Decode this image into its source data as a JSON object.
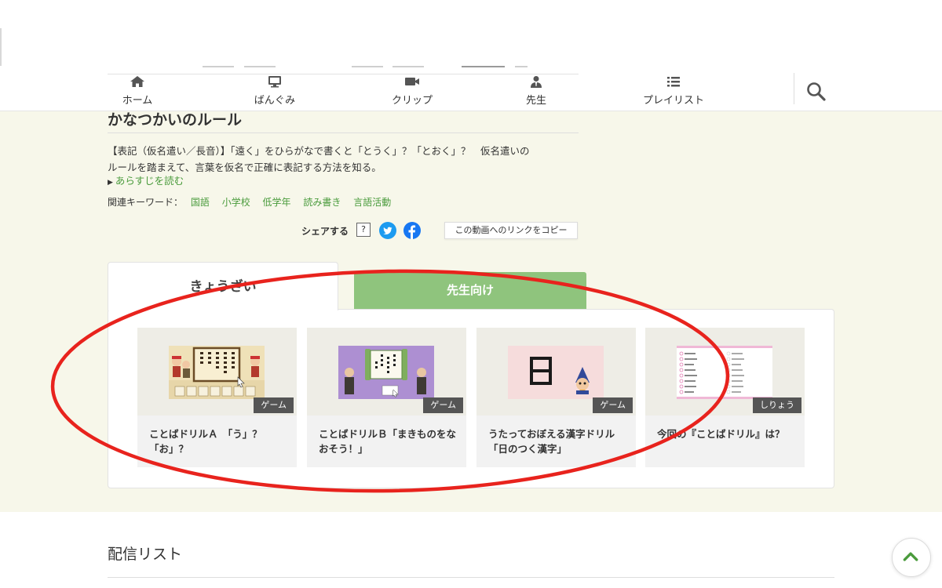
{
  "nav": {
    "items": [
      {
        "label": "ホーム",
        "icon": "home-icon"
      },
      {
        "label": "ばんぐみ",
        "icon": "tv-icon"
      },
      {
        "label": "クリップ",
        "icon": "video-camera-icon"
      },
      {
        "label": "先生",
        "icon": "teacher-icon"
      },
      {
        "label": "プレイリスト",
        "icon": "list-icon"
      }
    ],
    "search_icon": "search-icon"
  },
  "program": {
    "title": "かなつかいのルール",
    "description": "【表記（仮名遣い／長音）】「遠く」をひらがなで書くと「とうく」？「とおく」？　仮名遣いのルールを踏まえて、言葉を仮名で正確に表記する方法を知る。",
    "synopsis_link": "あらすじを読む",
    "keywords_label": "関連キーワード：",
    "keywords": [
      "国語",
      "小学校",
      "低学年",
      "読み書き",
      "言語活動"
    ]
  },
  "share": {
    "label": "シェアする",
    "help": "?",
    "copy_link": "この動画へのリンクをコピー"
  },
  "tabs": {
    "active": "きょうざい",
    "inactive": "先生向け"
  },
  "cards": [
    {
      "badge": "ゲーム",
      "title": "ことばドリルＡ　「う」？「お」？"
    },
    {
      "badge": "ゲーム",
      "title": "ことばドリルＢ「まきものをなおそう！」"
    },
    {
      "badge": "ゲーム",
      "title": "うたっておぼえる漢字ドリル「日のつく漢字」"
    },
    {
      "badge": "しりょう",
      "title": "今回の『ことばドリル』は？"
    }
  ],
  "card3_thumb_text": "日",
  "card2_thumb_text": "おいくがにかて",
  "card1_thumb_text": "とうくへおうさまがとおくへ",
  "bottom": {
    "list_title": "配信リスト"
  },
  "colors": {
    "accent_green": "#4a9b3c",
    "tab_green": "#8fc47d",
    "background_beige": "#f7f7ea",
    "annotation_red": "#e8231d",
    "twitter_blue": "#1d9bf0",
    "facebook_blue": "#1877f2"
  }
}
